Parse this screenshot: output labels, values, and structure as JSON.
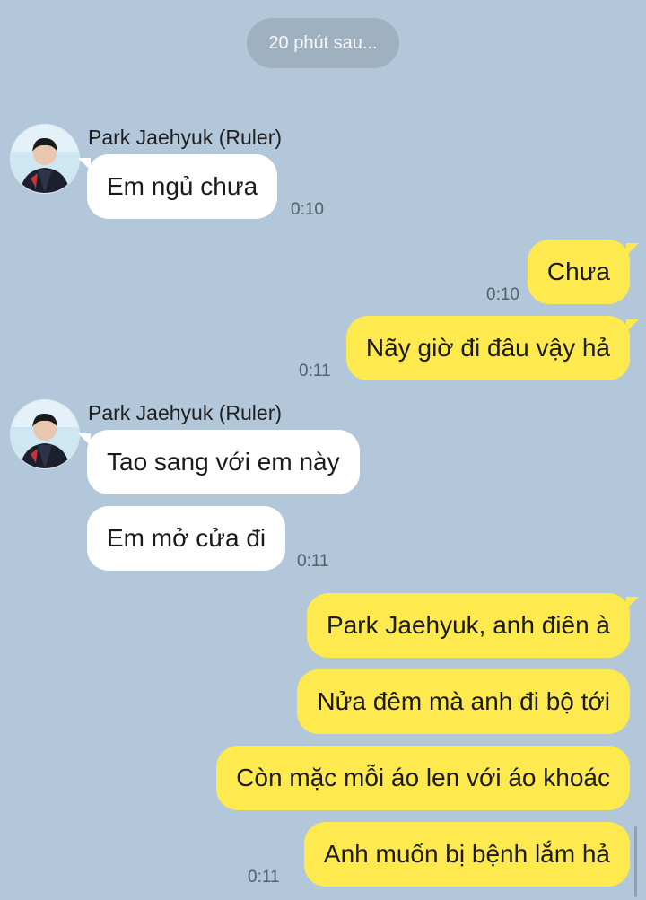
{
  "divider": {
    "text": "20 phút sau..."
  },
  "messages": [
    {
      "sender": "Park Jaehyuk (Ruler)",
      "text": "Em ngủ chưa",
      "time": "0:10"
    },
    {
      "text": "Chưa",
      "time": "0:10"
    },
    {
      "text": "Nãy giờ đi đâu vậy hả",
      "time": "0:11"
    },
    {
      "sender": "Park Jaehyuk (Ruler)",
      "text": "Tao sang với em này"
    },
    {
      "text": "Em mở cửa đi",
      "time": "0:11"
    },
    {
      "text": "Park Jaehyuk, anh điên à"
    },
    {
      "text": "Nửa đêm mà anh đi bộ tới"
    },
    {
      "text": "Còn mặc mỗi áo len với áo khoác"
    },
    {
      "text": "Anh muốn bị bệnh lắm hả",
      "time": "0:11"
    }
  ],
  "avatar_icon": "user-avatar-photo",
  "colors": {
    "background": "#b2c7da",
    "incoming_bubble": "#ffffff",
    "outgoing_bubble": "#fee94e",
    "divider": "#9fb1c1"
  }
}
